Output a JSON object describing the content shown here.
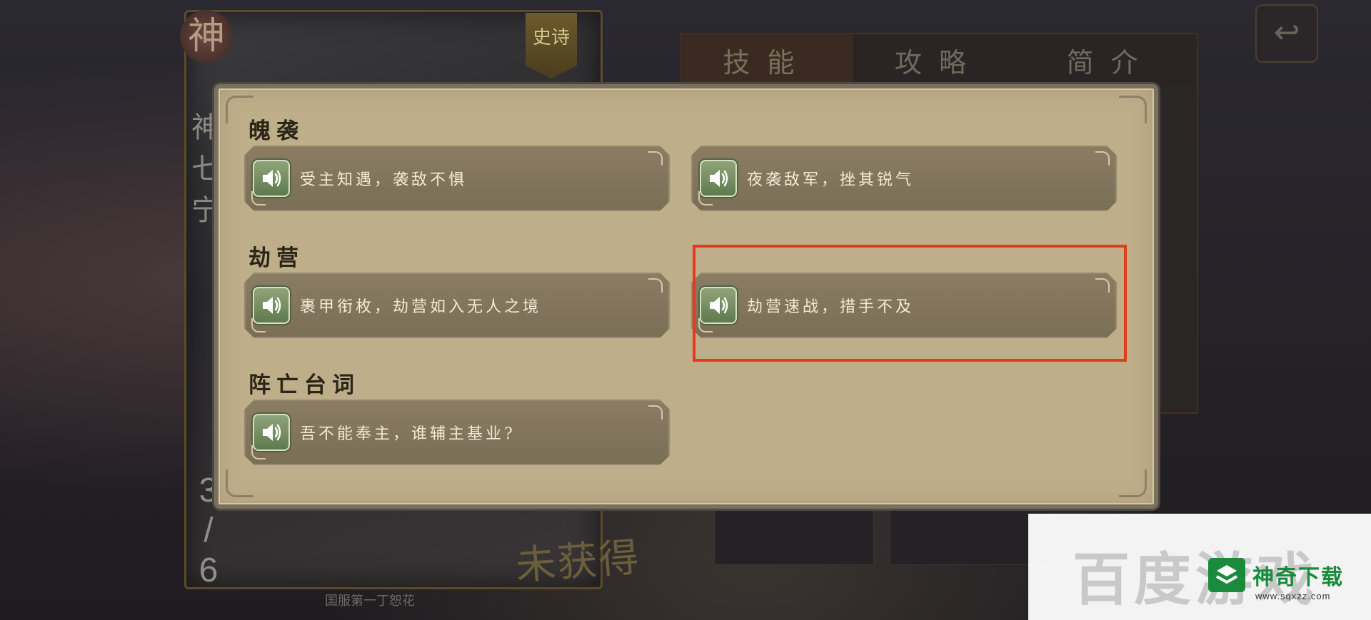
{
  "background": {
    "badge_char": "神",
    "tag_text": "史诗",
    "hero_name_chars": [
      "神",
      "七",
      "宁"
    ],
    "ratio_chars": [
      "3",
      "/",
      "6"
    ],
    "unobtained_label": "未获得",
    "footnote": "国服第一丁恕花",
    "tabs": [
      "技能",
      "攻略",
      "简介"
    ],
    "back_label": "↩"
  },
  "dialog": {
    "sections": [
      {
        "title": "魄袭",
        "lines": [
          "受主知遇，袭敌不惧",
          "夜袭敌军，挫其锐气"
        ]
      },
      {
        "title": "劫营",
        "lines": [
          "裹甲衔枚，劫营如入无人之境",
          "劫营速战，措手不及"
        ]
      },
      {
        "title": "阵亡台词",
        "lines": [
          "吾不能奉主，谁辅主基业?"
        ]
      }
    ],
    "highlight_color": "#e6391f",
    "speaker_icon": "speaker-icon"
  },
  "watermark": {
    "baidu_text": "百度游戏",
    "brand": "神奇下载",
    "url": "www.sqxzz.com"
  }
}
